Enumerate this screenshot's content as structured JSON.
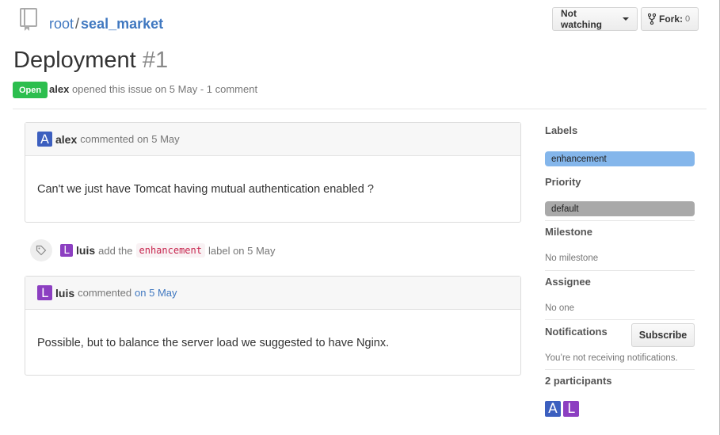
{
  "repo": {
    "owner": "root",
    "separator": "/",
    "name": "seal_market"
  },
  "actions": {
    "watch_label": "Not watching",
    "fork_label": "Fork:",
    "fork_count": "0"
  },
  "issue": {
    "title": "Deployment",
    "number": "#1",
    "state": "Open",
    "author": "alex",
    "meta_text": "opened this issue on 5 May - 1 comment"
  },
  "timeline": {
    "comments": [
      {
        "avatar_letter": "A",
        "author": "alex",
        "action": "commented",
        "date": "on 5 May",
        "body": "Can't we just have Tomcat having mutual authentication enabled ?"
      },
      {
        "avatar_letter": "L",
        "author": "luis",
        "action": "commented",
        "date": "on 5 May",
        "body": "Possible, but to balance the server load we suggested to have Nginx."
      }
    ],
    "event": {
      "icon": "tag-icon",
      "avatar_letter": "L",
      "author": "luis",
      "pre_text": "add the",
      "label": "enhancement",
      "post_text": "label on 5 May"
    }
  },
  "sidebar": {
    "labels_heading": "Labels",
    "label": "enhancement",
    "priority_heading": "Priority",
    "priority": "default",
    "milestone_heading": "Milestone",
    "milestone_value": "No milestone",
    "assignee_heading": "Assignee",
    "assignee_value": "No one",
    "notifications_heading": "Notifications",
    "subscribe_label": "Subscribe",
    "notifications_text": "You’re not receiving notifications.",
    "participants_heading": "2 participants",
    "participants": [
      "A",
      "L"
    ]
  },
  "colors": {
    "open_badge": "#2cbe4e",
    "link": "#4078c0",
    "label_enhancement": "#84b6eb",
    "label_default": "#a9a9a9",
    "avatar_alex": "#3c5fbf",
    "avatar_luis": "#8c3fc1"
  }
}
